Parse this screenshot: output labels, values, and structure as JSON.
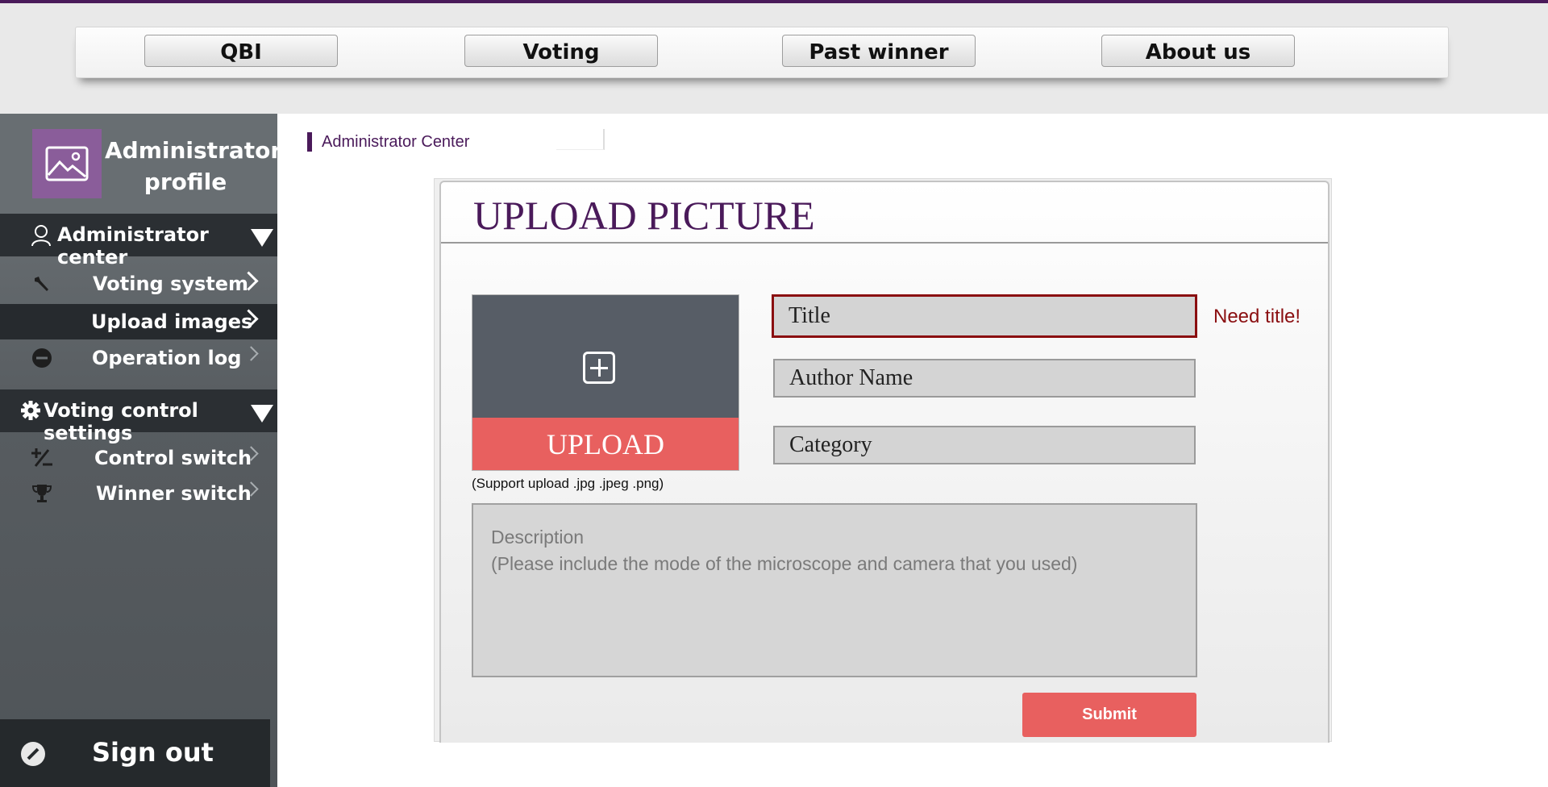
{
  "nav": {
    "items": [
      "QBI",
      "Voting",
      "Past winner",
      "About us"
    ]
  },
  "profile": {
    "icon": "image-icon",
    "name": "Administrator profile",
    "avatar_color": "#8a5d9a"
  },
  "sidebar": {
    "sections": [
      {
        "title": "Administrator center",
        "icon": "user-icon",
        "items": [
          {
            "label": "Voting system",
            "icon": "wrench-icon"
          },
          {
            "label": "Upload images",
            "icon": "",
            "active": true
          },
          {
            "label": "Operation log",
            "icon": "minus-circle-icon"
          }
        ]
      },
      {
        "title": "Voting control settings",
        "icon": "gear-icon",
        "items": [
          {
            "label": "Control switch",
            "icon": "plus-minus-icon"
          },
          {
            "label": "Winner switch",
            "icon": "trophy-icon"
          }
        ]
      }
    ],
    "signout": "Sign out"
  },
  "breadcrumb": "Administrator  Center",
  "form": {
    "heading": "UPLOAD PICTURE",
    "upload_label": "UPLOAD",
    "support_text": "(Support upload  .jpg .jpeg .png)",
    "title_placeholder": "Title",
    "title_error": "Need title!",
    "author_placeholder": "Author Name",
    "category_placeholder": "Category",
    "description_line1": "Description",
    "description_line2": "(Please include the mode of the microscope and camera that you used)",
    "submit_label": "Submit"
  },
  "colors": {
    "brand": "#4a1a5a",
    "accent": "#e8605f",
    "error": "#8a0e10"
  }
}
